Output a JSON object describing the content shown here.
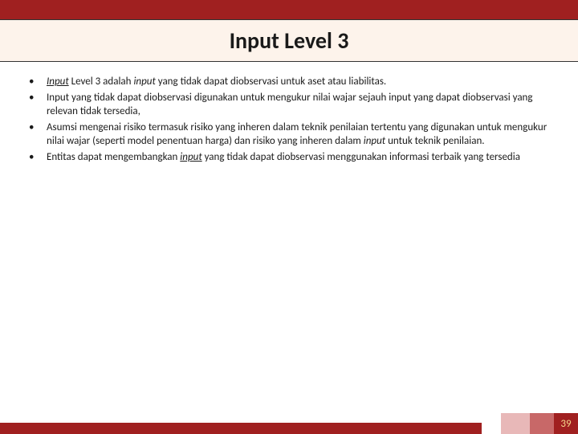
{
  "title": "Input Level 3",
  "bullets": [
    {
      "segments": [
        {
          "text": "Input",
          "style": "italic underline"
        },
        {
          "text": " Level 3 adalah "
        },
        {
          "text": "input",
          "style": "italic"
        },
        {
          "text": " yang tidak dapat diobservasi untuk aset atau liabilitas."
        }
      ]
    },
    {
      "segments": [
        {
          "text": "Input yang tidak dapat diobservasi digunakan untuk mengukur nilai wajar sejauh input yang dapat diobservasi yang relevan tidak tersedia,"
        }
      ]
    },
    {
      "segments": [
        {
          "text": "Asumsi mengenai risiko termasuk risiko yang inheren dalam teknik penilaian tertentu yang digunakan untuk mengukur nilai wajar (seperti model penentuan harga) dan risiko yang inheren dalam "
        },
        {
          "text": "input",
          "style": "italic"
        },
        {
          "text": " untuk teknik penilaian."
        }
      ]
    },
    {
      "segments": [
        {
          "text": "Entitas dapat mengembangkan "
        },
        {
          "text": "input",
          "style": "italic underline"
        },
        {
          "text": " yang tidak dapat diobservasi menggunakan informasi terbaik yang tersedia"
        }
      ]
    }
  ],
  "page_number": "39",
  "colors": {
    "brand": "#a02020",
    "title_band": "#fdf3eb",
    "footer_light": "#e8b8b8",
    "footer_mid": "#c86868",
    "page_num_color": "#f5d58a"
  }
}
